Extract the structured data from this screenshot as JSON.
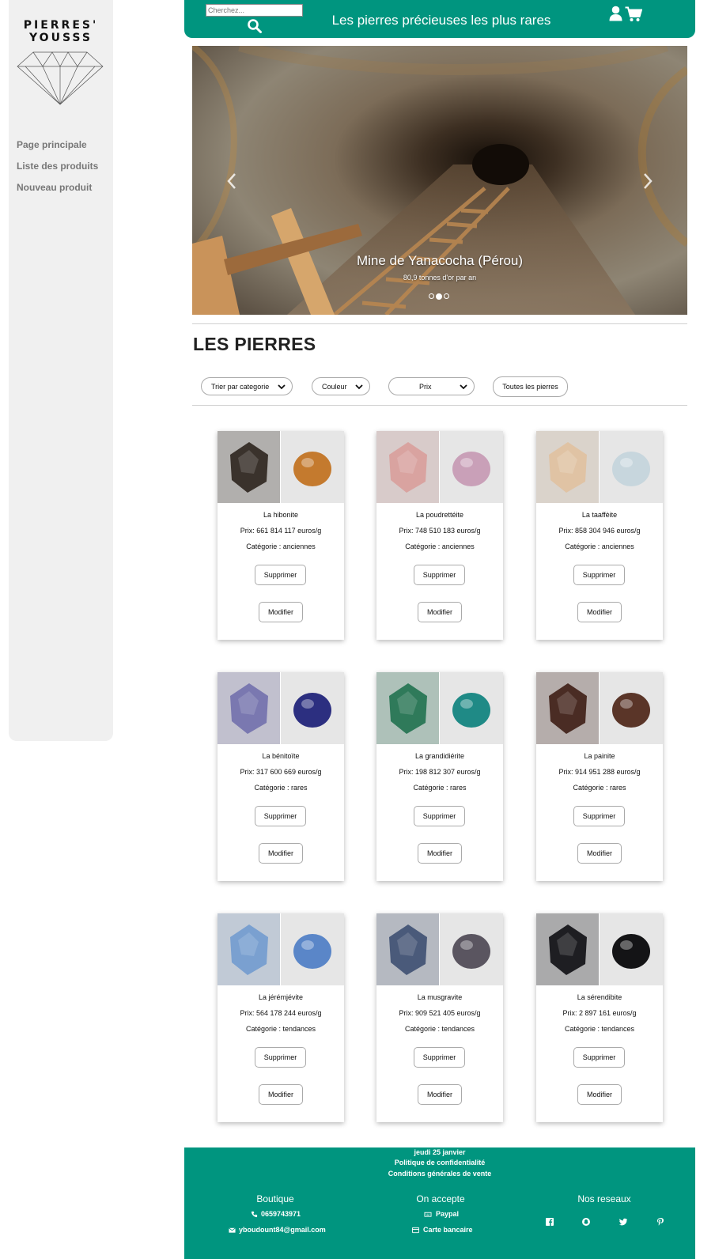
{
  "brand": {
    "logo_line1": "PIERRES'",
    "logo_line2": "YOUSSS"
  },
  "nav": {
    "items": [
      "Page principale",
      "Liste des produits",
      "Nouveau produit"
    ]
  },
  "header": {
    "search_placeholder": "Cherchez...",
    "title": "Les pierres précieuses les plus rares",
    "accent": "#00957f"
  },
  "carousel": {
    "title": "Mine de Yanacocha (Pérou)",
    "subtitle": "80,9 tonnes d'or par an",
    "slides": 3,
    "active": 1
  },
  "section": {
    "title": "LES PIERRES"
  },
  "filters": {
    "categorie": "Trier par categorie",
    "couleur": "Couleur",
    "prix": "Prix",
    "all": "Toutes les pierres"
  },
  "products": [
    {
      "name": "La hibonite",
      "price": "Prix: 661 814 117 euros/g",
      "category": "Catégorie : anciennes",
      "colors": [
        "#3a322c",
        "#c47a2e"
      ]
    },
    {
      "name": "La poudrettéite",
      "price": "Prix: 748 510 183 euros/g",
      "category": "Catégorie : anciennes",
      "colors": [
        "#d9a3a0",
        "#c9a0b8"
      ]
    },
    {
      "name": "La taaffèite",
      "price": "Prix: 858 304 946 euros/g",
      "category": "Catégorie : anciennes",
      "colors": [
        "#e0c3a4",
        "#c7d6dd"
      ]
    },
    {
      "name": "La bénitoïte",
      "price": "Prix: 317 600 669 euros/g",
      "category": "Catégorie : rares",
      "colors": [
        "#7a78b0",
        "#2c2f80"
      ]
    },
    {
      "name": "La grandidiérite",
      "price": "Prix: 198 812 307 euros/g",
      "category": "Catégorie : rares",
      "colors": [
        "#2f7a5a",
        "#1f8a86"
      ]
    },
    {
      "name": "La painite",
      "price": "Prix: 914 951 288 euros/g",
      "category": "Catégorie : rares",
      "colors": [
        "#4a2c24",
        "#5a3528"
      ]
    },
    {
      "name": "La jérémjévite",
      "price": "Prix: 564 178 244 euros/g",
      "category": "Catégorie : tendances",
      "colors": [
        "#7aa0d0",
        "#5a86c8"
      ]
    },
    {
      "name": "La musgravite",
      "price": "Prix: 909 521 405 euros/g",
      "category": "Catégorie : tendances",
      "colors": [
        "#4a5a7a",
        "#5a5560"
      ]
    },
    {
      "name": "La sérendibite",
      "price": "Prix: 2 897 161 euros/g",
      "category": "Catégorie : tendances",
      "colors": [
        "#1e1e22",
        "#141416"
      ]
    }
  ],
  "card_buttons": {
    "delete": "Supprimer",
    "edit": "Modifier"
  },
  "footer": {
    "date": "jeudi 25 janvier",
    "privacy": "Politique de confidentialité",
    "cgv": "Conditions générales de vente",
    "shop_title": "Boutique",
    "phone": "0659743971",
    "email": "yboudount84@gmail.com",
    "accept_title": "On accepte",
    "paypal": "Paypal",
    "card": "Carte bancaire",
    "social_title": "Nos reseaux"
  }
}
